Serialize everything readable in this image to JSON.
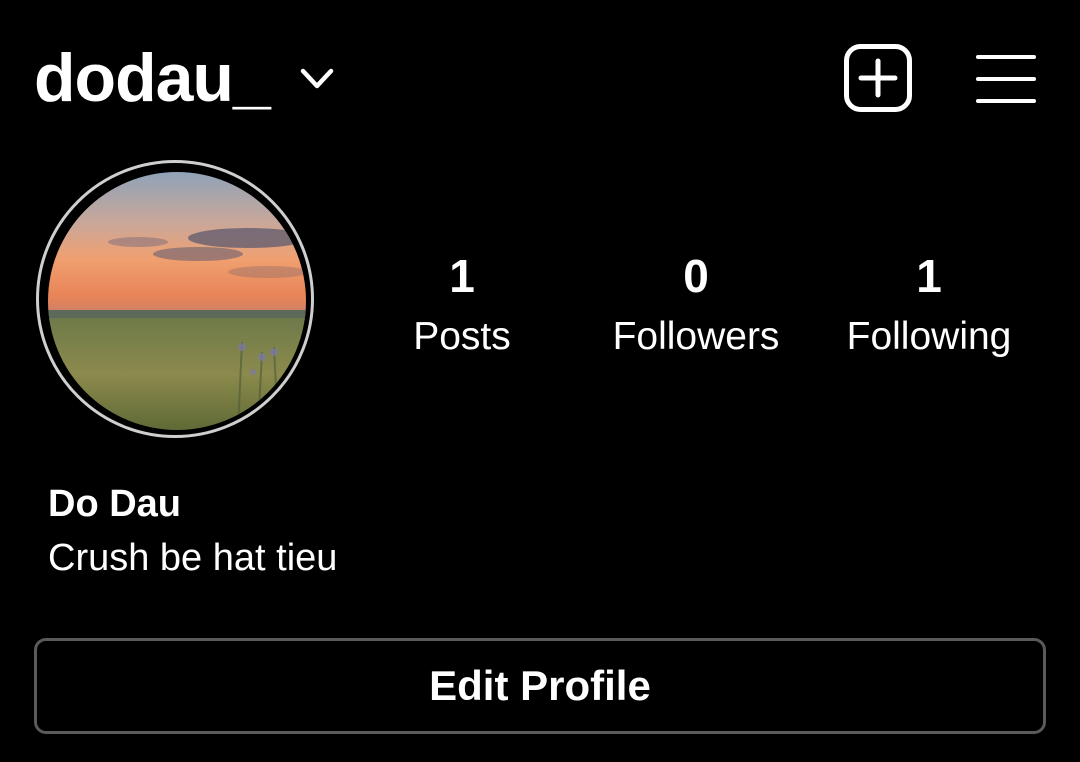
{
  "header": {
    "username": "dodau_",
    "icons": {
      "account_switch": "chevron-down-icon",
      "new_post": "add-post-icon",
      "menu": "hamburger-menu-icon"
    }
  },
  "profile": {
    "avatar_description": "profile photo",
    "display_name": "Do Dau",
    "bio": "Crush be hat tieu"
  },
  "stats": [
    {
      "count": "1",
      "label": "Posts"
    },
    {
      "count": "0",
      "label": "Followers"
    },
    {
      "count": "1",
      "label": "Following"
    }
  ],
  "actions": {
    "edit_profile_label": "Edit Profile"
  },
  "colors": {
    "background": "#000000",
    "text": "#ffffff",
    "button_border": "#5a5a5a",
    "avatar_ring": "#cfcfcf"
  }
}
